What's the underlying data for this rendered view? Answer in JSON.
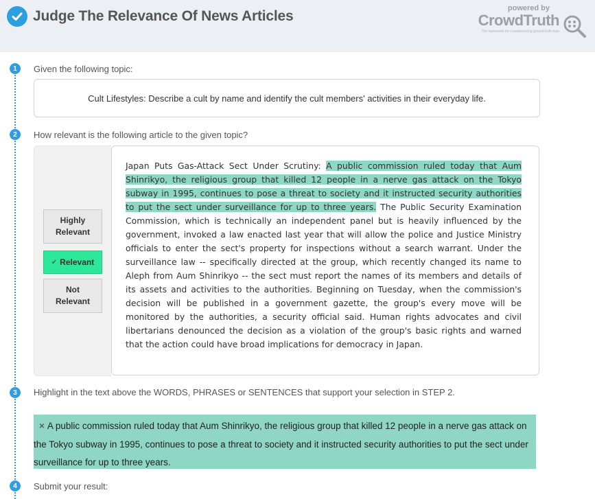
{
  "header": {
    "title": "Judge The Relevance Of News Articles",
    "powered_by": "powered by",
    "brand": "CrowdTruth",
    "tagline": "The framework for crowdsourcing ground truth data"
  },
  "steps": [
    {
      "num": "1",
      "label": "Given the following topic:"
    },
    {
      "num": "2",
      "label": "How relevant is the following article to the given topic?"
    },
    {
      "num": "3",
      "label": "Highlight in the text above the WORDS, PHRASES or SENTENCES that support your selection in STEP 2."
    },
    {
      "num": "4",
      "label": "Submit your result:"
    }
  ],
  "topic": "Cult Lifestyles: Describe a cult by name and identify the cult members' activities in their everyday life.",
  "relevance": {
    "options": [
      "Highly Relevant",
      "Relevant",
      "Not Relevant"
    ],
    "selected": "Relevant",
    "check_glyph": "✔"
  },
  "article": {
    "pre": "Japan Puts Gas-Attack Sect Under Scrutiny: ",
    "highlight": "A public commission ruled today that Aum Shinrikyo, the religious group that killed 12 people in a nerve gas attack on the Tokyo subway in 1995, continues to pose a threat to society and it instructed security authorities to put the sect under surveillance for up to three years.",
    "post": " The Public Security Examination Commission, which is technically an independent panel but is heavily influenced by the government, invoked a law enacted last year that will allow the police and Justice Ministry officials to enter the sect's property for inspections without a search warrant. Under the surveillance law -- specifically directed at the group, which recently changed its name to Aleph from Aum Shinrikyo -- the sect must report the names of its members and details of its assets and activities to the authorities. Beginning on Tuesday, when the commission's decision will be published in a government gazette, the group's every move will be monitored by the authorities, a security official said. Human rights advocates and civil libertarians denounced the decision as a violation of the group's basic rights and warned that the action could have broad implications for democracy in Japan."
  },
  "highlighted_selection": {
    "remove_glyph": "×",
    "text": "A public commission ruled today that Aum Shinrikyo, the religious group that killed 12 people in a nerve gas attack on the Tokyo subway in 1995, continues to pose a threat to society and it instructed security authorities to put the sect under surveillance for up to three years."
  },
  "colors": {
    "accent": "#2d9ee0",
    "selected": "#2ee89a",
    "highlight": "#8fd6c5"
  }
}
